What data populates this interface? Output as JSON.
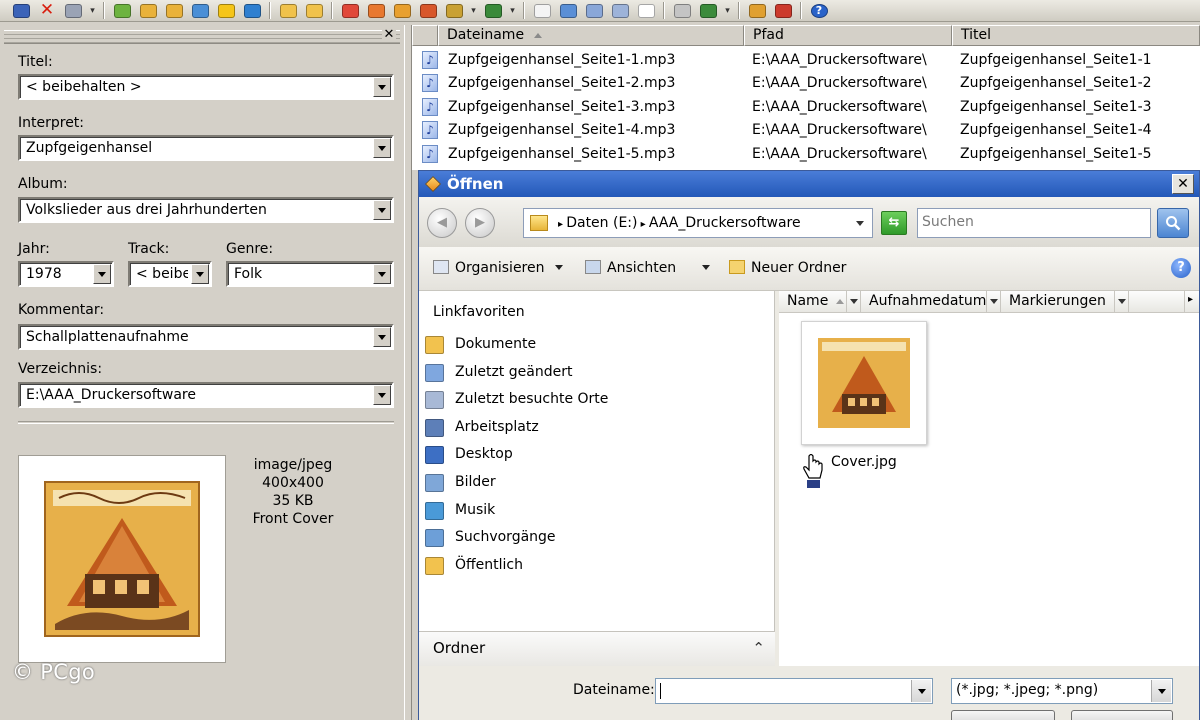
{
  "toolbar": {
    "buttons": [
      {
        "name": "save-icon",
        "color": "#3b63b8"
      },
      {
        "name": "delete-icon",
        "color": "#d81d0e"
      },
      {
        "name": "undo-icon",
        "color": "#9aa3b5"
      },
      {
        "name": "tag-from-filename-icon",
        "color": "#6db33f"
      },
      {
        "name": "filename-from-tag-icon",
        "color": "#e9b23a"
      },
      {
        "name": "tag-to-tag-icon",
        "color": "#e9b23a"
      },
      {
        "name": "export-icon",
        "color": "#4a8fd6"
      },
      {
        "name": "favorite-icon",
        "color": "#f5c518"
      },
      {
        "name": "refresh-icon",
        "color": "#2f80d0"
      },
      {
        "name": "folder-open-icon",
        "color": "#f0c24b"
      },
      {
        "name": "folder-up-icon",
        "color": "#f0c24b"
      },
      {
        "name": "freedb-icon",
        "color": "#e0483a"
      },
      {
        "name": "amazon-icon",
        "color": "#e8782f"
      },
      {
        "name": "discogs-icon",
        "color": "#e8a02f"
      },
      {
        "name": "musicbrainz-icon",
        "color": "#d8572b"
      },
      {
        "name": "web-source-icon",
        "color": "#c9a133"
      },
      {
        "name": "case-conversion-icon",
        "color": "#3a8a3a"
      },
      {
        "name": "text-file-icon",
        "color": "#f4f4f4"
      },
      {
        "name": "playlist-icon",
        "color": "#5a8fd6"
      },
      {
        "name": "list-export-icon",
        "color": "#8aa7d8"
      },
      {
        "name": "report-icon",
        "color": "#9db3d9"
      },
      {
        "name": "autonumber-icon",
        "color": "#ffffff"
      },
      {
        "name": "print-icon",
        "color": "#c4c4c4"
      },
      {
        "name": "web-icon",
        "color": "#3b8b3b"
      },
      {
        "name": "tools-icon",
        "color": "#e0a030"
      },
      {
        "name": "options-icon",
        "color": "#cc3a2c"
      },
      {
        "name": "help-icon",
        "color": "#2a63c9"
      }
    ],
    "help_glyph": "?"
  },
  "editor": {
    "close_glyph": "✕",
    "title_label": "Titel:",
    "title_value": "< beibehalten >",
    "artist_label": "Interpret:",
    "artist_value": "Zupfgeigenhansel",
    "album_label": "Album:",
    "album_value": "Volkslieder aus drei Jahrhunderten",
    "year_label": "Jahr:",
    "year_value": "1978",
    "track_label": "Track:",
    "track_value": "< beibe",
    "genre_label": "Genre:",
    "genre_value": "Folk",
    "comment_label": "Kommentar:",
    "comment_value": "Schallplattenaufnahme",
    "dir_label": "Verzeichnis:",
    "dir_value": "E:\\AAA_Druckersoftware",
    "cover_mime": "image/jpeg",
    "cover_size": "400x400",
    "cover_filesize": "35 KB",
    "cover_type": "Front Cover"
  },
  "filelist": {
    "columns": [
      "Dateiname",
      "Pfad",
      "Titel"
    ],
    "rows": [
      {
        "file": "Zupfgeigenhansel_Seite1-1.mp3",
        "path": "E:\\AAA_Druckersoftware\\",
        "title": "Zupfgeigenhansel_Seite1-1"
      },
      {
        "file": "Zupfgeigenhansel_Seite1-2.mp3",
        "path": "E:\\AAA_Druckersoftware\\",
        "title": "Zupfgeigenhansel_Seite1-2"
      },
      {
        "file": "Zupfgeigenhansel_Seite1-3.mp3",
        "path": "E:\\AAA_Druckersoftware\\",
        "title": "Zupfgeigenhansel_Seite1-3"
      },
      {
        "file": "Zupfgeigenhansel_Seite1-4.mp3",
        "path": "E:\\AAA_Druckersoftware\\",
        "title": "Zupfgeigenhansel_Seite1-4"
      },
      {
        "file": "Zupfgeigenhansel_Seite1-5.mp3",
        "path": "E:\\AAA_Druckersoftware\\",
        "title": "Zupfgeigenhansel_Seite1-5"
      }
    ]
  },
  "dialog": {
    "title": "Öffnen",
    "close_glyph": "✕",
    "breadcrumb": [
      "Daten (E:)",
      "AAA_Druckersoftware"
    ],
    "search_placeholder": "Suchen",
    "commands": {
      "organize": "Organisieren",
      "views": "Ansichten",
      "new_folder": "Neuer Ordner"
    },
    "help_glyph": "?",
    "favorites_header": "Linkfavoriten",
    "favorites": [
      {
        "label": "Dokumente",
        "icon": "documents-folder-icon",
        "color": "#f2c24e"
      },
      {
        "label": "Zuletzt geändert",
        "icon": "recently-changed-icon",
        "color": "#7fa7df"
      },
      {
        "label": "Zuletzt besuchte Orte",
        "icon": "recent-places-icon",
        "color": "#a8b9d6"
      },
      {
        "label": "Arbeitsplatz",
        "icon": "computer-icon",
        "color": "#5d7fb8"
      },
      {
        "label": "Desktop",
        "icon": "desktop-icon",
        "color": "#3d6fc4"
      },
      {
        "label": "Bilder",
        "icon": "pictures-icon",
        "color": "#7fa7d8"
      },
      {
        "label": "Musik",
        "icon": "music-icon",
        "color": "#4a9ad8"
      },
      {
        "label": "Suchvorgänge",
        "icon": "searches-icon",
        "color": "#6d9fd8"
      },
      {
        "label": "Öffentlich",
        "icon": "public-folder-icon",
        "color": "#f2c24e"
      }
    ],
    "folders_label": "Ordner",
    "folders_chevron": "⌃",
    "file_columns": [
      "Name",
      "Aufnahmedatum",
      "Markierungen"
    ],
    "files": [
      {
        "name": "Cover.jpg"
      }
    ],
    "filename_label": "Dateiname:",
    "filename_value": "",
    "filter_value": "(*.jpg; *.jpeg; *.png)"
  },
  "watermark": "© PCgo"
}
